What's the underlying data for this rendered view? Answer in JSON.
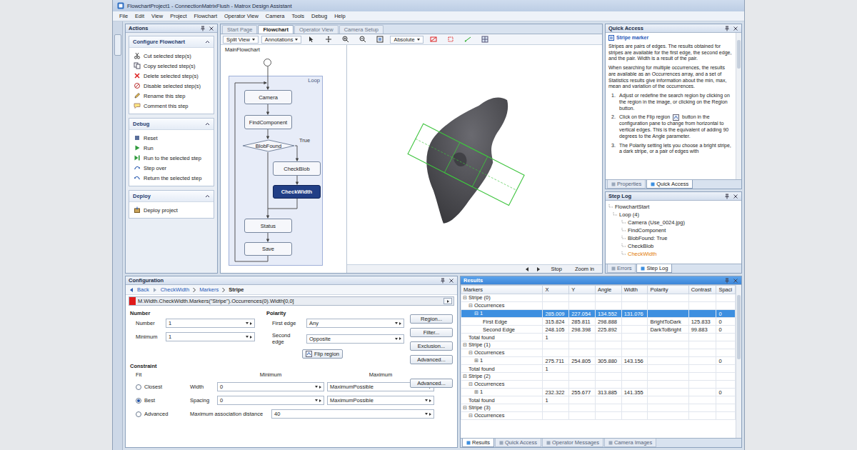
{
  "window": {
    "title": "FlowchartProject1 - ConnectionMatrixFlush - Matrox Design Assistant"
  },
  "menu": [
    "File",
    "Edit",
    "View",
    "Project",
    "Flowchart",
    "Operator View",
    "Camera",
    "Tools",
    "Debug",
    "Help"
  ],
  "tasks": {
    "title": "Actions",
    "sections": [
      {
        "title": "Configure Flowchart",
        "items": [
          {
            "label": "Cut selected step(s)",
            "kind": "cut"
          },
          {
            "label": "Copy selected step(s)",
            "kind": "copy"
          },
          {
            "label": "Delete selected step(s)",
            "kind": "delete"
          },
          {
            "label": "Disable selected step(s)",
            "kind": "disable"
          },
          {
            "label": "Rename this step",
            "kind": "rename"
          },
          {
            "label": "Comment this step",
            "kind": "comment"
          }
        ]
      },
      {
        "title": "Debug",
        "items": [
          {
            "label": "Reset",
            "kind": "reset"
          },
          {
            "label": "Run",
            "kind": "run"
          },
          {
            "label": "Run to the selected step",
            "kind": "runto"
          },
          {
            "label": "Step over",
            "kind": "step"
          },
          {
            "label": "Return the selected step",
            "kind": "back"
          }
        ]
      },
      {
        "title": "Deploy",
        "items": [
          {
            "label": "Deploy project",
            "kind": "deploy"
          }
        ]
      }
    ]
  },
  "editor": {
    "tabs": [
      {
        "label": "Start Page",
        "selected": false
      },
      {
        "label": "Flowchart",
        "selected": true
      },
      {
        "label": "Operator View",
        "selected": false
      },
      {
        "label": "Camera Setup",
        "selected": false
      }
    ],
    "toolbar": [
      "Split View",
      "Annotations",
      "Absolute"
    ],
    "flowchart": {
      "title": "MainFlowchart",
      "loop_label": "Loop",
      "branch_label": "True",
      "nodes": [
        {
          "label": "",
          "kind": "start",
          "selected": false
        },
        {
          "label": "Camera",
          "kind": "step",
          "selected": false
        },
        {
          "label": "FindComponent",
          "kind": "step",
          "selected": false
        },
        {
          "label": "BlobFound",
          "kind": "decision",
          "selected": false
        },
        {
          "label": "CheckBlob",
          "kind": "step",
          "selected": false
        },
        {
          "label": "CheckWidth",
          "kind": "step",
          "selected": true
        },
        {
          "label": "Status",
          "kind": "step",
          "selected": false
        },
        {
          "label": "Save",
          "kind": "step",
          "selected": false
        }
      ]
    },
    "image_bar": [
      "Stop",
      "Zoom in"
    ]
  },
  "quick_access": {
    "title": "Quick Access",
    "topic": "Stripe marker",
    "paragraphs": [
      "Stripes are pairs of edges. The results obtained for stripes are available for the first edge, the second edge, and the pair. Width is a result of the pair.",
      "When searching for multiple occurrences, the results are available as an Occurrences array, and a set of Statistics results give information about the min, max, mean and variation of the occurrences."
    ],
    "steps": [
      {
        "num": "1.",
        "parts": [
          "Adjust or redefine the search region by clicking on the region in the image, or clicking on the Region button."
        ]
      },
      {
        "num": "2.",
        "parts": [
          "Click on the Flip region",
          "button in the configuration pane to change from horizontal to vertical edges. This is the equivalent of adding 90 degrees to the Angle parameter."
        ]
      },
      {
        "num": "3.",
        "parts": [
          "The Polarity setting lets you choose a bright stripe, a dark stripe, or a pair of edges with"
        ]
      }
    ],
    "tabs": [
      {
        "label": "Properties",
        "selected": false
      },
      {
        "label": "Quick Access",
        "selected": true
      }
    ]
  },
  "step_log": {
    "title": "Step Log",
    "items": [
      {
        "label": "FlowchartStart",
        "kind": "root",
        "selected": false
      },
      {
        "label": "Loop (4)",
        "kind": "loop",
        "selected": false
      },
      {
        "label": "Camera (Use_0024.jpg)",
        "kind": "child",
        "selected": false
      },
      {
        "label": "FindComponent",
        "kind": "child",
        "selected": false
      },
      {
        "label": "BlobFound: True",
        "kind": "child",
        "selected": false
      },
      {
        "label": "CheckBlob",
        "kind": "child",
        "selected": false
      },
      {
        "label": "CheckWidth",
        "kind": "child",
        "selected": true
      }
    ],
    "tabs": [
      {
        "label": "Errors",
        "selected": false
      },
      {
        "label": "Step Log",
        "selected": true
      }
    ]
  },
  "configuration": {
    "title": "Configuration",
    "breadcrumb": [
      "Back",
      "CheckWidth",
      "Markers",
      "Stripe"
    ],
    "expression": "M.Width.CheckWidth.Markers(\"Stripe\").Occurrences(0).Width[0,0]",
    "number": {
      "title": "Number",
      "fields": [
        {
          "label": "Number",
          "value": "1"
        },
        {
          "label": "Minimum",
          "value": "1"
        }
      ]
    },
    "polarity": {
      "title": "Polarity",
      "fields": [
        {
          "label": "First edge",
          "value": "Any"
        },
        {
          "label": "Second edge",
          "value": "Opposite"
        }
      ],
      "flip": "Flip region"
    },
    "side_buttons": [
      "Region...",
      "Filter...",
      "Exclusion...",
      "Advanced..."
    ],
    "constraint": {
      "title": "Constraint",
      "fit_label": "Fit",
      "min_header": "Minimum",
      "max_header": "Maximum",
      "fit_options": [
        {
          "label": "Closest",
          "selected": false
        },
        {
          "label": "Best",
          "selected": true
        },
        {
          "label": "Advanced",
          "selected": false
        }
      ],
      "rows": [
        {
          "label": "Width",
          "min": "0",
          "max": "MaximumPossible"
        },
        {
          "label": "Spacing",
          "min": "0",
          "max": "MaximumPossible"
        }
      ],
      "assoc": {
        "label": "Maximum association distance",
        "value": "40"
      },
      "advanced": "Advanced..."
    }
  },
  "results": {
    "title": "Results",
    "columns": [
      "Markers",
      "X",
      "Y",
      "Angle",
      "Width",
      "Polarity",
      "Contrast",
      "Spaci"
    ],
    "rows": [
      {
        "kind": "group",
        "toggle": "⊟",
        "selected": false,
        "cells": [
          "Stripe (0)",
          "",
          "",
          "",
          "",
          "",
          "",
          ""
        ]
      },
      {
        "kind": "sub",
        "toggle": "⊟",
        "selected": false,
        "cells": [
          "Occurrences",
          "",
          "",
          "",
          "",
          "",
          "",
          ""
        ]
      },
      {
        "kind": "occ",
        "toggle": "⊟",
        "selected": true,
        "cells": [
          "1",
          "285.009",
          "227.054",
          "134.552",
          "131.076",
          "",
          "",
          "0"
        ]
      },
      {
        "kind": "edge",
        "toggle": "",
        "selected": false,
        "cells": [
          "First Edge",
          "315.824",
          "285.811",
          "298.888",
          "",
          "BrightToDark",
          "125.833",
          "0"
        ]
      },
      {
        "kind": "edge",
        "toggle": "",
        "selected": false,
        "cells": [
          "Second Edge",
          "248.105",
          "298.398",
          "225.892",
          "",
          "DarkToBright",
          "99.883",
          "0"
        ]
      },
      {
        "kind": "sub",
        "toggle": "",
        "selected": false,
        "cells": [
          "Total found",
          "1",
          "",
          "",
          "",
          "",
          "",
          ""
        ]
      },
      {
        "kind": "group",
        "toggle": "⊟",
        "selected": false,
        "cells": [
          "Stripe (1)",
          "",
          "",
          "",
          "",
          "",
          "",
          ""
        ]
      },
      {
        "kind": "sub",
        "toggle": "⊟",
        "selected": false,
        "cells": [
          "Occurrences",
          "",
          "",
          "",
          "",
          "",
          "",
          ""
        ]
      },
      {
        "kind": "occ",
        "toggle": "⊞",
        "selected": false,
        "cells": [
          "1",
          "275.711",
          "254.805",
          "305.880",
          "143.156",
          "",
          "",
          "0"
        ]
      },
      {
        "kind": "sub",
        "toggle": "",
        "selected": false,
        "cells": [
          "Total found",
          "1",
          "",
          "",
          "",
          "",
          "",
          ""
        ]
      },
      {
        "kind": "group",
        "toggle": "⊟",
        "selected": false,
        "cells": [
          "Stripe (2)",
          "",
          "",
          "",
          "",
          "",
          "",
          ""
        ]
      },
      {
        "kind": "sub",
        "toggle": "⊟",
        "selected": false,
        "cells": [
          "Occurrences",
          "",
          "",
          "",
          "",
          "",
          "",
          ""
        ]
      },
      {
        "kind": "occ",
        "toggle": "⊞",
        "selected": false,
        "cells": [
          "1",
          "232.322",
          "255.677",
          "313.885",
          "141.355",
          "",
          "",
          "0"
        ]
      },
      {
        "kind": "sub",
        "toggle": "",
        "selected": false,
        "cells": [
          "Total found",
          "1",
          "",
          "",
          "",
          "",
          "",
          ""
        ]
      },
      {
        "kind": "group",
        "toggle": "⊟",
        "selected": false,
        "cells": [
          "Stripe (3)",
          "",
          "",
          "",
          "",
          "",
          "",
          ""
        ]
      },
      {
        "kind": "sub",
        "toggle": "⊟",
        "selected": false,
        "cells": [
          "Occurrences",
          "",
          "",
          "",
          "",
          "",
          "",
          ""
        ]
      }
    ],
    "tabs": [
      {
        "label": "Results",
        "selected": true
      },
      {
        "label": "Quick Access",
        "selected": false
      },
      {
        "label": "Operator Messages",
        "selected": false
      },
      {
        "label": "Camera Images",
        "selected": false
      }
    ]
  }
}
